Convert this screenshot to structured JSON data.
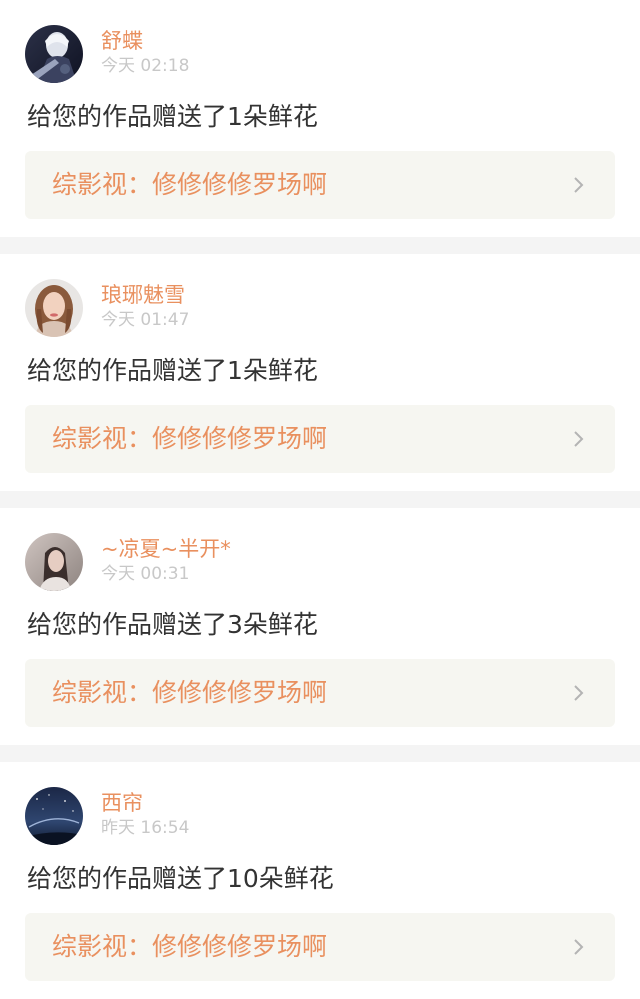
{
  "notifications": [
    {
      "username": "舒蝶",
      "time": "今天 02:18",
      "message": "给您的作品赠送了1朵鲜花",
      "work": "综影视：修修修修罗场啊",
      "avatar_icon": "anime-character-avatar"
    },
    {
      "username": "琅琊魅雪",
      "time": "今天 01:47",
      "message": "给您的作品赠送了1朵鲜花",
      "work": "综影视：修修修修罗场啊",
      "avatar_icon": "woman-portrait-avatar"
    },
    {
      "username": "~凉夏~半开*",
      "time": "今天 00:31",
      "message": "给您的作品赠送了3朵鲜花",
      "work": "综影视：修修修修罗场啊",
      "avatar_icon": "girl-portrait-avatar"
    },
    {
      "username": "西帘",
      "time": "昨天 16:54",
      "message": "给您的作品赠送了10朵鲜花",
      "work": "综影视：修修修修罗场啊",
      "avatar_icon": "night-sky-avatar"
    }
  ],
  "colors": {
    "accent": "#e9905f",
    "text": "#333333",
    "muted": "#c8c8c8",
    "link_bg": "#f6f6f1",
    "separator": "#f4f4f4"
  }
}
